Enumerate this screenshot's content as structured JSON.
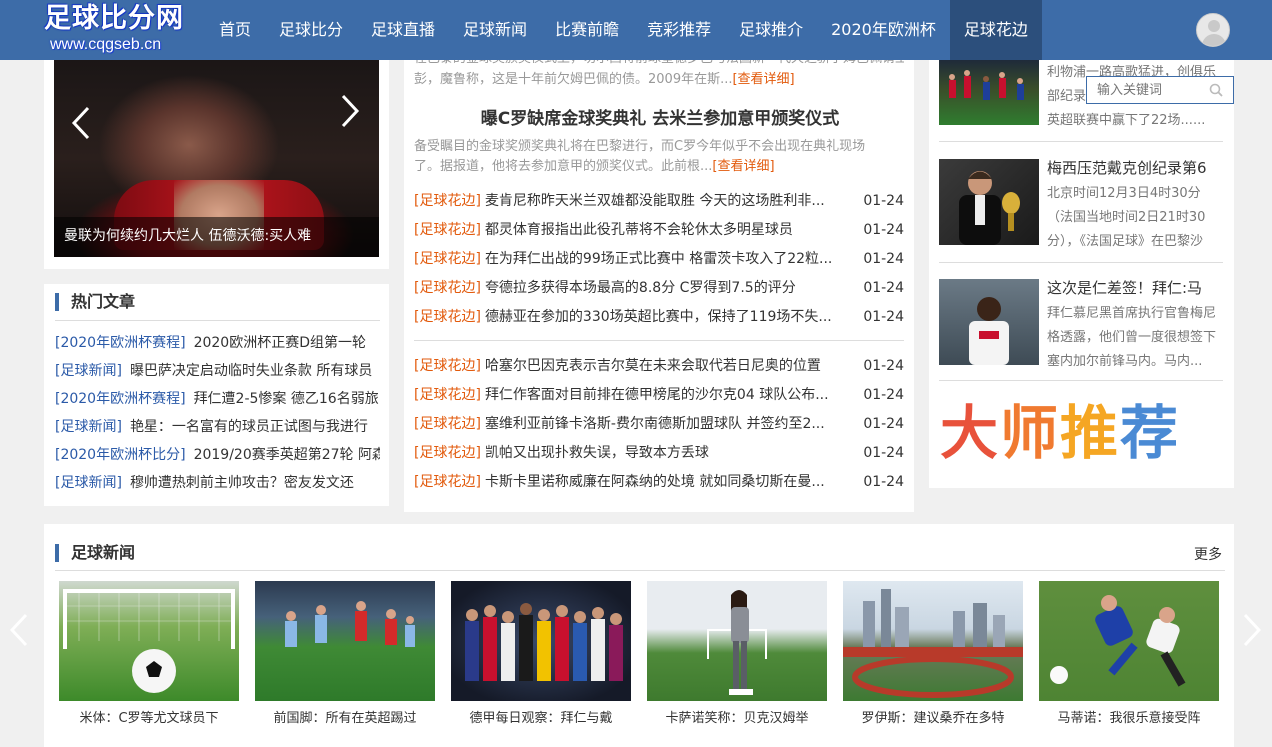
{
  "logo": {
    "title": "足球比分网",
    "subtitle": "www.cqgseb.cn"
  },
  "nav": {
    "items": [
      "首页",
      "足球比分",
      "足球直播",
      "足球新闻",
      "比赛前瞻",
      "竞彩推荐",
      "足球推介",
      "2020年欧洲杯",
      "足球花边"
    ],
    "active_index": 8
  },
  "slider": {
    "caption": "曼联为何续约几大烂人 伍德沃德:买人难"
  },
  "hot": {
    "title": "热门文章",
    "items": [
      {
        "tag": "[2020年欧洲杯赛程]",
        "text": "2020欧洲杯正赛D组第一轮"
      },
      {
        "tag": "[足球新闻]",
        "text": "曝巴萨决定启动临时失业条款 所有球员"
      },
      {
        "tag": "[2020年欧洲杯赛程]",
        "text": "拜仁遭2-5惨案 德乙16名弱旅"
      },
      {
        "tag": "[足球新闻]",
        "text": "艳星：一名富有的球员正试图与我进行"
      },
      {
        "tag": "[2020年欧洲杯比分]",
        "text": "2019/20赛季英超第27轮 阿森"
      },
      {
        "tag": "[足球新闻]",
        "text": "穆帅遭热刺前主帅攻击？密友发文还"
      }
    ]
  },
  "middle": {
    "top_snippet_line1": "在巴黎的金球奖颁奖仪式上，切尔西将前球星德罗巴与法国新一代天之骄子姆巴佩请上台",
    "top_snippet_line2": "彭，魔鲁称，这是十年前欠姆巴佩的债。2009年在斯...",
    "more_label": "[查看详细]",
    "headline": "曝C罗缺席金球奖典礼 去米兰参加意甲颁奖仪式",
    "summary_line1": "备受瞩目的金球奖颁奖典礼将在巴黎进行，而C罗今年似乎不会出现在典礼现场",
    "summary_line2": "了。据报道，他将去参加意甲的颁奖仪式。此前根...",
    "news_group1": [
      {
        "tag": "[足球花边]",
        "title": "麦肯尼称昨天米兰双雄都没能取胜 今天的这场胜利非...",
        "date": "01-24"
      },
      {
        "tag": "[足球花边]",
        "title": "都灵体育报指出此役孔蒂将不会轮休太多明星球员",
        "date": "01-24"
      },
      {
        "tag": "[足球花边]",
        "title": "在为拜仁出战的99场正式比赛中 格雷茨卡攻入了22粒...",
        "date": "01-24"
      },
      {
        "tag": "[足球花边]",
        "title": "夸德拉多获得本场最高的8.8分 C罗得到7.5的评分",
        "date": "01-24"
      },
      {
        "tag": "[足球花边]",
        "title": "德赫亚在参加的330场英超比赛中，保持了119场不失...",
        "date": "01-24"
      }
    ],
    "news_group2": [
      {
        "tag": "[足球花边]",
        "title": "哈塞尔巴因克表示吉尔莫在未来会取代若日尼奥的位置",
        "date": "01-24"
      },
      {
        "tag": "[足球花边]",
        "title": "拜仁作客面对目前排在德甲榜尾的沙尔克04 球队公布...",
        "date": "01-24"
      },
      {
        "tag": "[足球花边]",
        "title": "塞维利亚前锋卡洛斯-费尔南德斯加盟球队 并签约至2...",
        "date": "01-24"
      },
      {
        "tag": "[足球花边]",
        "title": "凯帕又出现扑救失误，导致本方丢球",
        "date": "01-24"
      },
      {
        "tag": "[足球花边]",
        "title": "卡斯卡里诺称威廉在阿森纳的处境 就如同桑切斯在曼...",
        "date": "01-24"
      }
    ]
  },
  "side": {
    "search_placeholder": "输入关键词",
    "items": [
      {
        "title": "利物浦一路高歌猛进",
        "desc": [
          "利物浦一路高歌猛进，创俱乐",
          "部纪录",
          "英超联赛中赢下了22场......"
        ]
      },
      {
        "title": "梅西压范戴克创纪录第6",
        "desc": [
          "北京时间12月3日4时30分",
          "（法国当地时间2日21时30",
          "分），《法国足球》在巴黎沙"
        ]
      },
      {
        "title": "这次是仁差签！拜仁:马",
        "desc": [
          "拜仁慕尼黑首席执行官鲁梅尼",
          "格透露，他们曾一度很想签下",
          "塞内加尔前锋马内。马内..."
        ]
      }
    ],
    "banner": [
      "大",
      "师",
      "推",
      "荐"
    ],
    "banner_colors": [
      "#e8523b",
      "#f07a30",
      "#f5a623",
      "#4a8ad4"
    ]
  },
  "news": {
    "title": "足球新闻",
    "more": "更多",
    "cards": [
      "米体：C罗等尤文球员下",
      "前国脚：所有在英超踢过",
      "德甲每日观察：拜仁与戴",
      "卡萨诺笑称：贝克汉姆举",
      "罗伊斯：建议桑乔在多特",
      "马蒂诺：我很乐意接受阵"
    ]
  },
  "colors": {
    "nav_bg": "#3d6ca8",
    "nav_active": "#2c4f7c",
    "tag_orange": "#e25a0c",
    "tag_blue": "#2b5aa8"
  },
  "icons": [
    "user-avatar-icon",
    "search-icon",
    "chevron-left-icon",
    "chevron-right-icon"
  ]
}
